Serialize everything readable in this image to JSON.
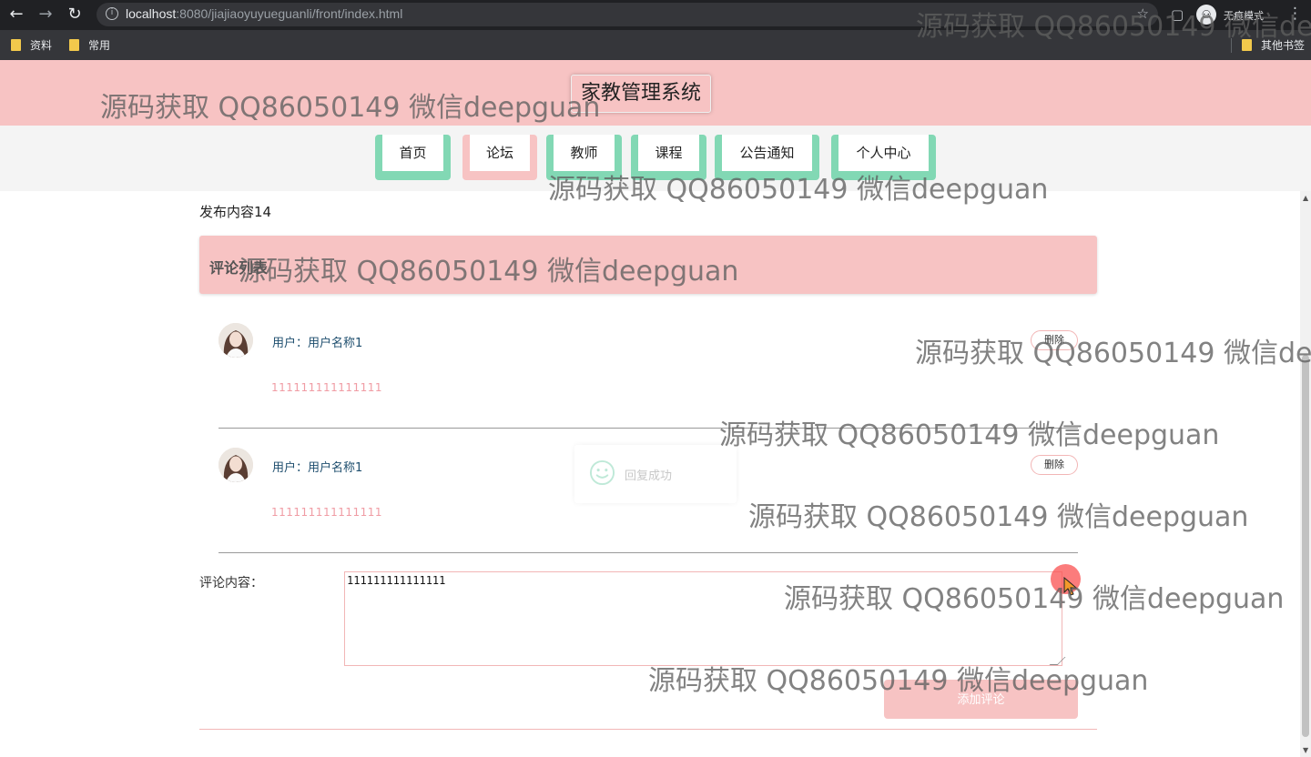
{
  "browser": {
    "url_host": "localhost",
    "url_rest": ":8080/jiajiaoyuyueguanli/front/index.html",
    "incognito_label": "无痕模式",
    "bookmarks": [
      "资料",
      "常用"
    ],
    "other_bookmarks": "其他书签"
  },
  "site": {
    "title": "家教管理系统",
    "nav": [
      "首页",
      "论坛",
      "教师",
      "课程",
      "公告通知",
      "个人中心"
    ],
    "active_nav_index": 1
  },
  "post": {
    "title": "发布内容14",
    "comments_heading": "评论列表"
  },
  "comments": [
    {
      "user": "用户：用户名称1",
      "text": "111111111111111",
      "delete_label": "删除"
    },
    {
      "user": "用户：用户名称1",
      "text": "111111111111111",
      "delete_label": "删除"
    }
  ],
  "toast": {
    "text": "回复成功"
  },
  "form": {
    "label": "评论内容：",
    "value": "111111111111111",
    "submit_label": "添加评论"
  },
  "watermark": "源码获取 QQ86050149 微信deepguan",
  "colors": {
    "header_pink": "#f7c3c3",
    "nav_green": "#82d8b4",
    "user_text": "#1e4e6e",
    "comment_text": "#f09ca4"
  }
}
